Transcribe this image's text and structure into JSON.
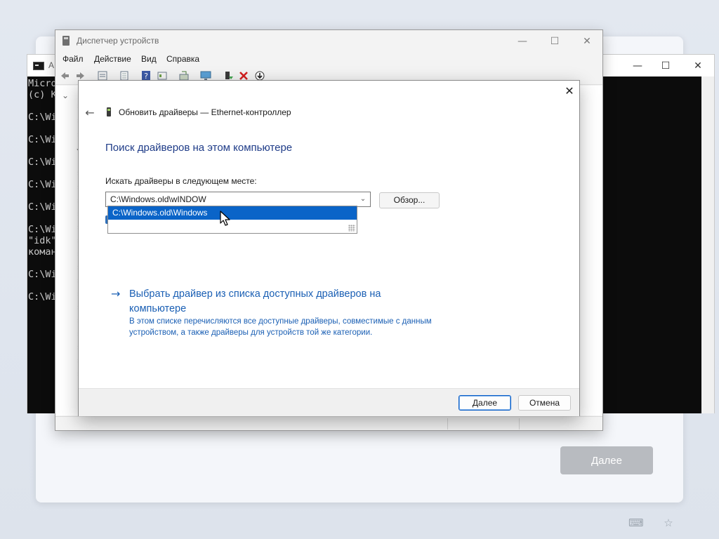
{
  "oobe": {
    "next_label": "Далее",
    "tray_icons": [
      "keyboard-icon",
      "accessibility-icon"
    ]
  },
  "console": {
    "title": "А",
    "window_controls": [
      "—",
      "☐",
      "✕"
    ],
    "lines": [
      "Micro",
      "(c) K",
      "",
      "C:\\Wi",
      "",
      "C:\\Wi",
      "",
      "C:\\Wi",
      "",
      "C:\\Wi",
      "",
      "C:\\Wi",
      "",
      "C:\\Wi",
      "\"idk\"",
      "коман",
      "",
      "C:\\Wi",
      "",
      "C:\\Wi"
    ]
  },
  "device_manager": {
    "title": "Диспетчер устройств",
    "window_controls": [
      "—",
      "☐",
      "✕"
    ],
    "menu": [
      "Файл",
      "Действие",
      "Вид",
      "Справка"
    ],
    "toolbar": [
      "back-icon",
      "forward-icon",
      "properties-icon",
      "list-icon",
      "help-icon",
      "view-icon",
      "scan-icon",
      "monitor-icon",
      "update-driver-icon",
      "remove-icon",
      "disable-icon"
    ],
    "tree_chevrons": [
      "⌄",
      "›",
      "›",
      "›",
      "⌄",
      "›",
      "›",
      "›",
      "›",
      "›",
      "›",
      "›",
      "›",
      "›",
      "›",
      "›",
      "›",
      "›",
      "›",
      "›",
      "›"
    ]
  },
  "dialog": {
    "close": "✕",
    "back": "←",
    "title": "Обновить драйверы — Ethernet-контроллер",
    "heading": "Поиск драйверов на этом компьютере",
    "search_label": "Искать драйверы в следующем месте:",
    "path_value": "C:\\Windows.old\\wINDOW",
    "autocomplete_suggestion": "C:\\Windows.old\\Windows",
    "browse_label": "Обзор...",
    "link_arrow": "→",
    "link_text": "Выбрать драйвер из списка доступных драйверов на компьютере",
    "link_description": "В этом списке перечисляются все доступные драйверы, совместимые с данным устройством, а также драйверы для устройств той же категории.",
    "next_label": "Далее",
    "cancel_label": "Отмена"
  }
}
